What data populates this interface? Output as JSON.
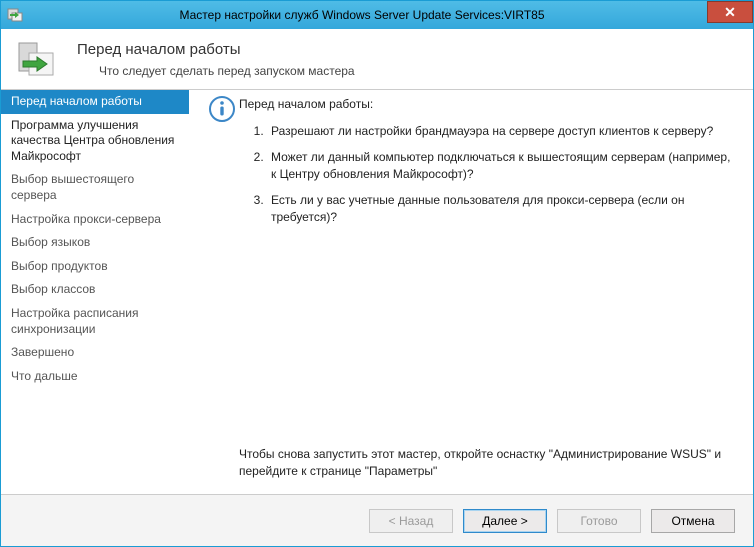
{
  "titlebar": {
    "title": "Мастер настройки служб Windows Server Update Services:VIRT85",
    "close_glyph": "✕"
  },
  "header": {
    "title": "Перед началом работы",
    "subtitle": "Что следует сделать перед запуском мастера"
  },
  "sidebar": {
    "items": [
      {
        "label": "Перед началом работы",
        "state": "selected"
      },
      {
        "label": "Программа улучшения качества Центра обновления Майкрософт",
        "state": "active-dark"
      },
      {
        "label": "Выбор вышестоящего сервера",
        "state": ""
      },
      {
        "label": "Настройка прокси-сервера",
        "state": ""
      },
      {
        "label": "Выбор языков",
        "state": ""
      },
      {
        "label": "Выбор продуктов",
        "state": ""
      },
      {
        "label": "Выбор классов",
        "state": ""
      },
      {
        "label": "Настройка расписания синхронизации",
        "state": ""
      },
      {
        "label": "Завершено",
        "state": ""
      },
      {
        "label": "Что дальше",
        "state": ""
      }
    ]
  },
  "content": {
    "heading": "Перед началом работы:",
    "items": [
      "Разрешают ли настройки брандмауэра на сервере доступ клиентов к серверу?",
      "Может ли данный компьютер подключаться к вышестоящим серверам (например, к Центру обновления Майкрософт)?",
      "Есть ли у вас учетные данные пользователя для прокси-сервера (если он требуется)?"
    ],
    "footnote": "Чтобы снова запустить этот мастер, откройте оснастку \"Администрирование WSUS\" и перейдите к странице \"Параметры\""
  },
  "buttons": {
    "back": "< Назад",
    "next": "Далее >",
    "finish": "Готово",
    "cancel": "Отмена"
  },
  "icons": {
    "info_color": "#3C87C7"
  }
}
